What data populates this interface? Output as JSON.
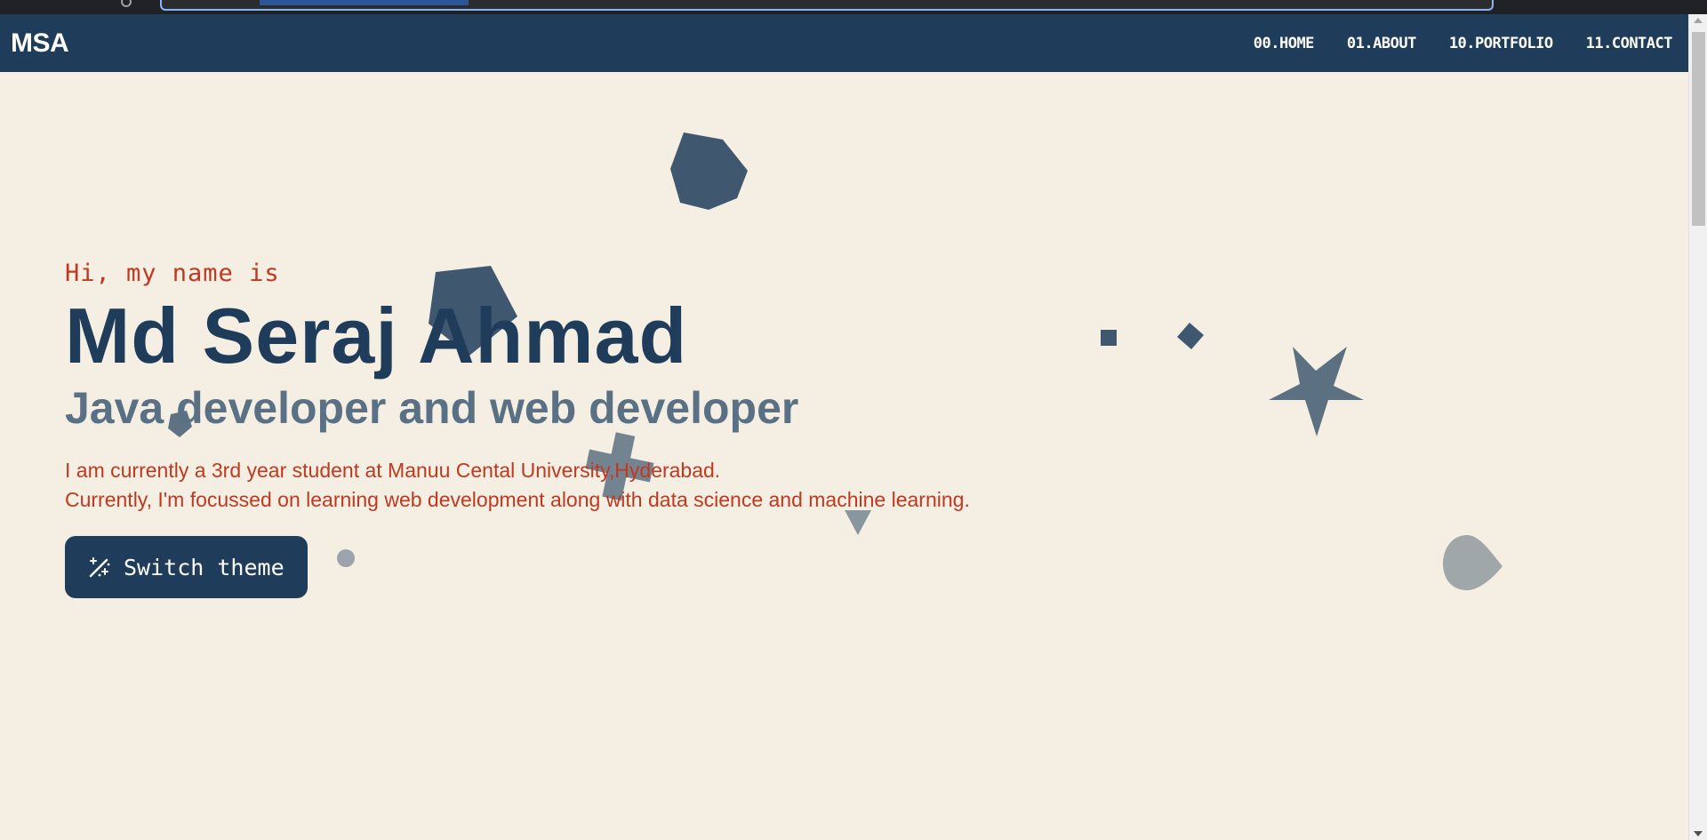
{
  "navbar": {
    "logo": "MSA",
    "links": [
      {
        "label": "00.HOME"
      },
      {
        "label": "01.ABOUT"
      },
      {
        "label": "10.PORTFOLIO"
      },
      {
        "label": "11.CONTACT"
      }
    ]
  },
  "hero": {
    "greeting": "Hi, my name is",
    "name": "Md Seraj Ahmad",
    "role": "Java developer and web developer",
    "bio_line1": "I am currently a 3rd year student at Manuu Cental University,Hyderabad.",
    "bio_line2": "Currently, I'm focussed on learning web development along with data science and machine learning.",
    "theme_button": {
      "label": "Switch theme",
      "icon": "magic-wand-icon"
    }
  },
  "colors": {
    "navy": "#1f3d5a",
    "accent_red": "#c0391f",
    "background": "#f5efe3",
    "muted": "#5a7084"
  }
}
